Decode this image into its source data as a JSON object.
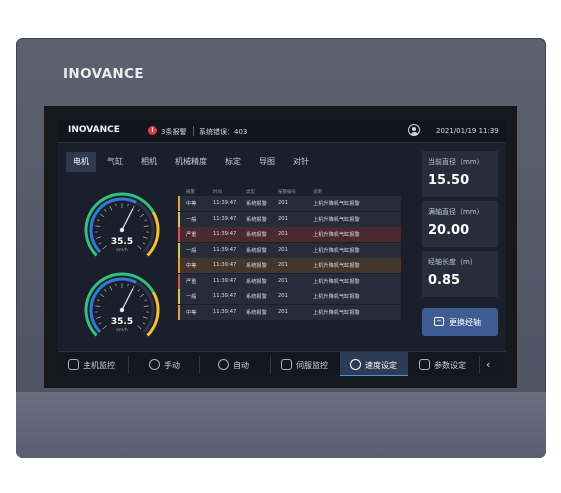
{
  "device": {
    "brand": "INOVANCE"
  },
  "topbar": {
    "logo": "INOVANCE",
    "alarm_count": "3条报警",
    "alarm_badge": "!",
    "error": "系统错误：403",
    "datetime": "2021/01/19  11:39"
  },
  "tabs": [
    {
      "label": "电机",
      "active": true
    },
    {
      "label": "气缸"
    },
    {
      "label": "相机"
    },
    {
      "label": "机械精度"
    },
    {
      "label": "标定"
    },
    {
      "label": "导图"
    },
    {
      "label": "对针"
    }
  ],
  "gauges": [
    {
      "value": "35.5",
      "unit": "km/h",
      "level": 0.6
    },
    {
      "value": "35.5",
      "unit": "km/h",
      "level": 0.6
    }
  ],
  "alarm_table": {
    "headers": [
      "报警",
      "时间",
      "类型",
      "报警编号",
      "说明"
    ],
    "rows": [
      {
        "level": "中等",
        "time": "11:39:47",
        "type": "系统报警",
        "code": "201",
        "desc": "上机升降机气缸报警",
        "color": "#e0a23a",
        "sev": "normal"
      },
      {
        "level": "一般",
        "time": "11:39:47",
        "type": "系统报警",
        "code": "201",
        "desc": "上机升降机气缸报警",
        "color": "#d6c94a",
        "sev": "normal"
      },
      {
        "level": "严重",
        "time": "11:39:47",
        "type": "系统报警",
        "code": "201",
        "desc": "上机升降机气缸报警",
        "color": "#e05050",
        "sev": "high"
      },
      {
        "level": "一般",
        "time": "11:39:47",
        "type": "系统报警",
        "code": "201",
        "desc": "上机升降机气缸报警",
        "color": "#d6c94a",
        "sev": "normal"
      },
      {
        "level": "中等",
        "time": "11:39:47",
        "type": "系统报警",
        "code": "201",
        "desc": "上机升降机气缸报警",
        "color": "#e0a23a",
        "sev": "mid"
      },
      {
        "level": "严重",
        "time": "11:39:47",
        "type": "系统报警",
        "code": "201",
        "desc": "上机升降机气缸报警",
        "color": "#e05050",
        "sev": "normal"
      },
      {
        "level": "一般",
        "time": "11:39:47",
        "type": "系统报警",
        "code": "201",
        "desc": "上机升降机气缸报警",
        "color": "#d6c94a",
        "sev": "normal"
      },
      {
        "level": "中等",
        "time": "11:39:47",
        "type": "系统报警",
        "code": "201",
        "desc": "上机升降机气缸报警",
        "color": "#e0a23a",
        "sev": "normal"
      }
    ]
  },
  "side": {
    "cards": [
      {
        "label": "当前直径（mm）",
        "value": "15.50"
      },
      {
        "label": "满轴直径（mm）",
        "value": "20.00"
      },
      {
        "label": "经轴长度（m）",
        "value": "0.85"
      }
    ],
    "swap_button": "更换经轴"
  },
  "bottom_nav": [
    {
      "label": "主机监控",
      "icon": "monitor-icon"
    },
    {
      "label": "手动",
      "icon": "hand-icon"
    },
    {
      "label": "自动",
      "icon": "auto-icon"
    },
    {
      "label": "伺服监控",
      "icon": "servo-icon"
    },
    {
      "label": "速度设定",
      "icon": "speed-icon",
      "active": true
    },
    {
      "label": "参数设定",
      "icon": "params-icon"
    }
  ],
  "colors": {
    "accent": "#4a90e2",
    "gauge_green": "#2ec27e",
    "gauge_yellow": "#f2c230",
    "gauge_blue": "#2d7fd1"
  }
}
